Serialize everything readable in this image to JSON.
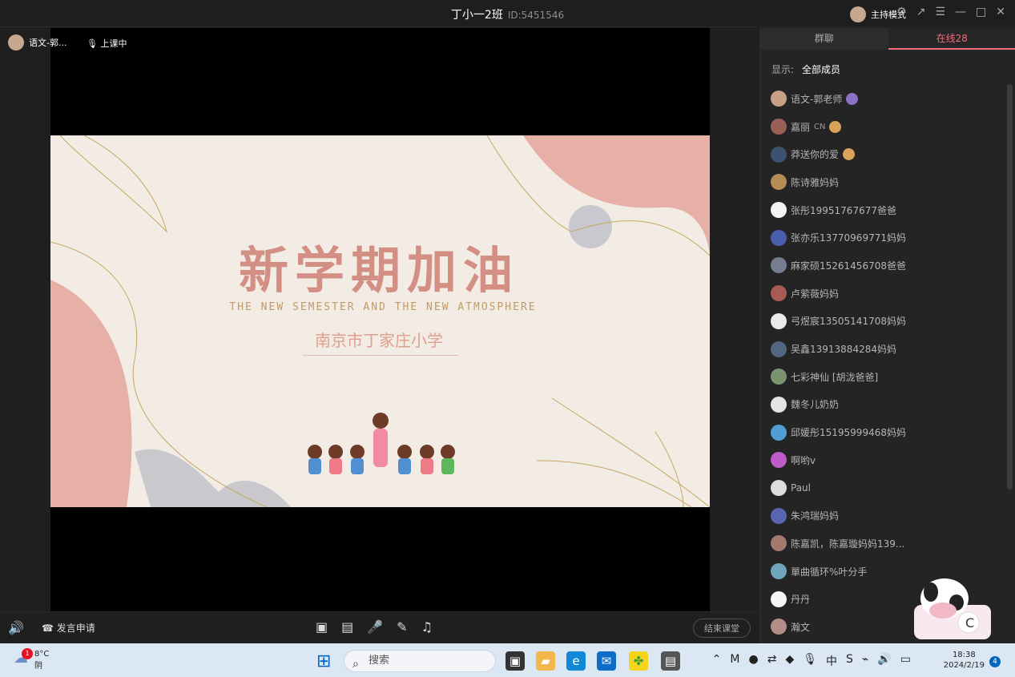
{
  "window": {
    "title": "丁小一2班",
    "class_id": "ID:5451546",
    "mode_label": "主持模式"
  },
  "classroom": {
    "presenter_name": "语文-郭...",
    "status": "上课中"
  },
  "slide": {
    "title": "新学期加油",
    "subtitle": "THE NEW SEMESTER AND THE NEW ATMOSPHERE",
    "school": "南京市丁家庄小学"
  },
  "bottom_controls": {
    "request_label": "发言申请",
    "end_label": "结束课堂"
  },
  "side_panel": {
    "tabs": [
      "群聊",
      "在线28"
    ],
    "filter_label": "显示:",
    "filter_value": "全部成员",
    "members": [
      {
        "name": "语文-郭老师",
        "tag": ""
      },
      {
        "name": "嘉丽",
        "tag": "CN"
      },
      {
        "name": "莽送你的爱",
        "tag": ""
      },
      {
        "name": "陈诗雅妈妈",
        "tag": ""
      },
      {
        "name": "张彤19951767677爸爸",
        "tag": ""
      },
      {
        "name": "张亦乐13770969771妈妈",
        "tag": ""
      },
      {
        "name": "麻家硕15261456708爸爸",
        "tag": ""
      },
      {
        "name": "卢萦薇妈妈",
        "tag": ""
      },
      {
        "name": "弓煜宸13505141708妈妈",
        "tag": ""
      },
      {
        "name": "吴鑫13913884284妈妈",
        "tag": ""
      },
      {
        "name": "七彩神仙 [胡泷爸爸]",
        "tag": ""
      },
      {
        "name": "魏冬儿奶奶",
        "tag": ""
      },
      {
        "name": "邱媛彤15195999468妈妈",
        "tag": ""
      },
      {
        "name": "啊哟v",
        "tag": ""
      },
      {
        "name": "Paul",
        "tag": ""
      },
      {
        "name": "朱鸿瑞妈妈",
        "tag": ""
      },
      {
        "name": "陈嘉凯，陈嘉璇妈妈139...",
        "tag": ""
      },
      {
        "name": "單曲循环%叶分手",
        "tag": ""
      },
      {
        "name": "丹丹",
        "tag": ""
      },
      {
        "name": "瀚文",
        "tag": ""
      }
    ]
  },
  "taskbar": {
    "weather_temp": "8°C",
    "weather_desc": "阴",
    "weather_badge": "1",
    "search_placeholder": "搜索",
    "time": "18:38",
    "date": "2024/2/19",
    "notification_count": "4"
  }
}
